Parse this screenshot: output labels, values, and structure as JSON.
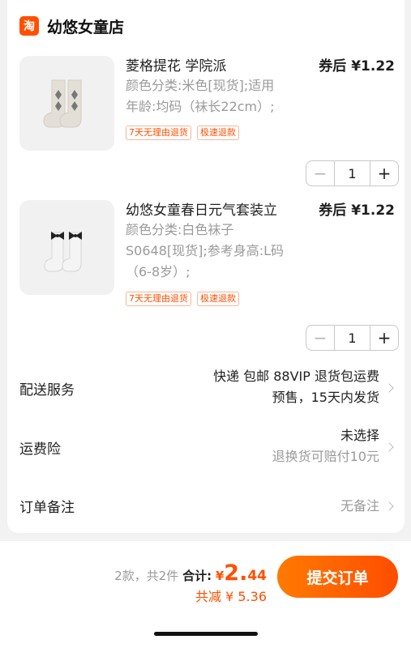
{
  "shop": {
    "badge": "淘",
    "name": "幼悠女童店"
  },
  "items": [
    {
      "title": "菱格提花 学院派",
      "price": "券后 ¥1.22",
      "sku_lines": [
        "颜色分类:米色[现货];适用",
        "年龄:均码（袜长22cm）;"
      ],
      "tags": [
        "7天无理由退货",
        "极速退款"
      ],
      "qty": "1",
      "image_icon": "argyle-socks-icon"
    },
    {
      "title": "幼悠女童春日元气套装立",
      "price": "券后 ¥1.22",
      "sku_lines": [
        "颜色分类:白色袜子",
        "S0648[现货];参考身高:L码",
        "（6-8岁）;"
      ],
      "tags": [
        "7天无理由退货",
        "极速退款"
      ],
      "qty": "1",
      "image_icon": "bow-socks-icon"
    }
  ],
  "stepper": {
    "minus": "−",
    "plus": "+"
  },
  "delivery": {
    "label": "配送服务",
    "line1": "快递 包邮 88VIP 退货包运费",
    "line2": "预售，15天内发货"
  },
  "insurance": {
    "label": "运费险",
    "line1": "未选择",
    "line2": "退换货可赔付10元"
  },
  "note": {
    "label": "订单备注",
    "value": "无备注"
  },
  "footer": {
    "count": "2款，共2件",
    "total_label": "合计:",
    "currency": "¥",
    "total_main": "2.",
    "total_decimal": "44",
    "discount": "共减 ¥ 5.36",
    "submit": "提交订单"
  },
  "colors": {
    "accent": "#ff5000",
    "muted": "#9a9a9a",
    "background": "#f2f2f2"
  }
}
